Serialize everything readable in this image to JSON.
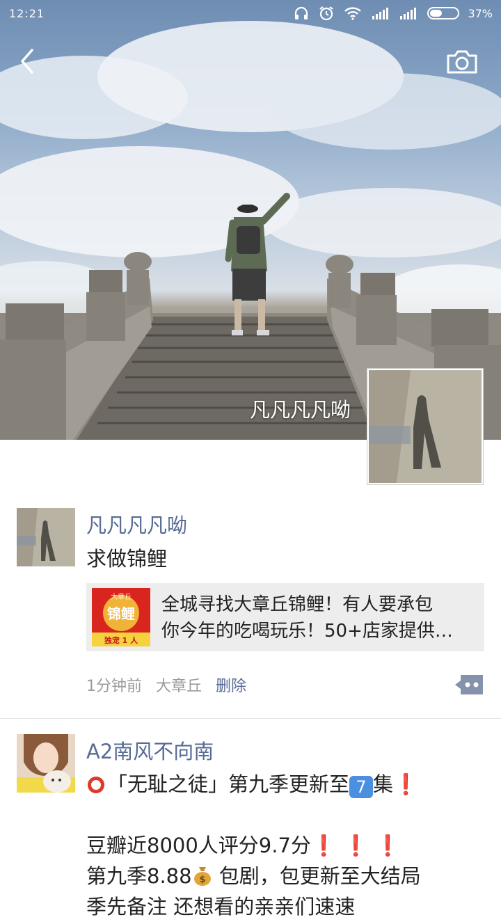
{
  "status_bar": {
    "time": "12:21",
    "battery": "37%"
  },
  "header": {
    "back_icon": "chevron-left-icon",
    "camera_icon": "camera-icon"
  },
  "profile": {
    "name": "凡凡凡凡呦"
  },
  "posts": [
    {
      "author": "凡凡凡凡呦",
      "text": "求做锦鲤",
      "link": {
        "title_line1": "全城寻找大章丘锦鲤！有人要承包",
        "title_line2": "你今年的吃喝玩乐！50+店家提供…",
        "thumb_top": "大章丘",
        "thumb_main": "锦鲤",
        "thumb_bottom": "独宠 1 人"
      },
      "time": "1分钟前",
      "location": "大章丘",
      "delete_label": "删除"
    },
    {
      "author": "A2南风不向南",
      "line1_a": "「无耻之徒」第九季更新至",
      "line1_key": "7",
      "line1_b": "集",
      "line2_a": "豆瓣近8000人评分9.7分",
      "line3_a": "第九季8.88",
      "line3_b": " 包剧，包更新至大结局",
      "line4": "   季先备注 还想看的亲亲们速速 "
    }
  ],
  "colors": {
    "link_blue": "#576b95",
    "text": "#222222",
    "meta_gray": "#9b9b9b",
    "card_bg": "#ededed",
    "alert_red": "#d9231c"
  }
}
